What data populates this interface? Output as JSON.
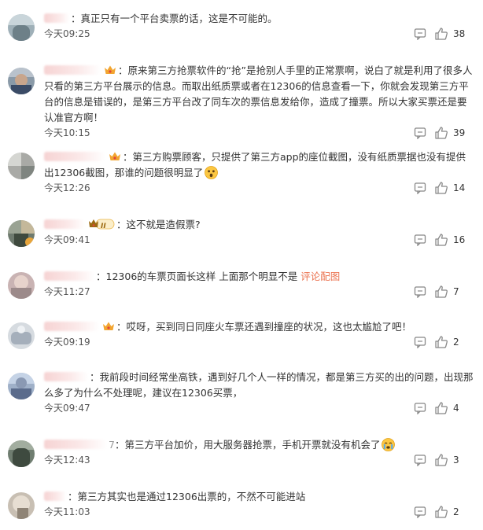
{
  "comments": [
    {
      "text": "真正只有一个平台卖票的话，这是不可能的。",
      "time": "今天09:25",
      "likes": "38"
    },
    {
      "text": "原来第三方抢票软件的“抢”是抢别人手里的正常票啊，说白了就是利用了很多人只看的第三方平台展示的信息。而取出纸质票或者在12306的信息查看一下，你就会发现第三方平台的信息是错误的，是第三方平台改了同车次的票信息发给你，造成了撞票。所以大家买票还是要认准官方啊！",
      "time": "今天10:15",
      "likes": "39"
    },
    {
      "text": "第三方购票顾客，只提供了第三方app的座位截图，没有纸质票据也没有提供出12306截图，那谁的问题很明显了",
      "time": "今天12:26",
      "likes": "14"
    },
    {
      "text": "这不就是造假票?",
      "time": "今天09:41",
      "likes": "16",
      "vip_label": "II"
    },
    {
      "text": "12306的车票页面长这样 上面那个明显不是 ",
      "link": "评论配图",
      "time": "今天11:27",
      "likes": "7"
    },
    {
      "text": "哎呀，买到同日同座火车票还遇到撞座的状况，这也太尴尬了吧！",
      "time": "今天09:19",
      "likes": "2"
    },
    {
      "text": "我前段时间经常坐高铁，遇到好几个人一样的情况，都是第三方买的出的问题，出现那么多了为什么不处理呢，建议在12306买票，",
      "time": "今天09:47",
      "likes": "4"
    },
    {
      "text": "第三方平台加价，用大服务器抢票，手机开票就没有机会了",
      "time": "今天12:43",
      "likes": "3",
      "name_suffix": "7"
    },
    {
      "text": "第三方其实也是通过12306出票的，不然不可能进站",
      "time": "今天11:03",
      "likes": "2"
    }
  ],
  "separator": "："
}
